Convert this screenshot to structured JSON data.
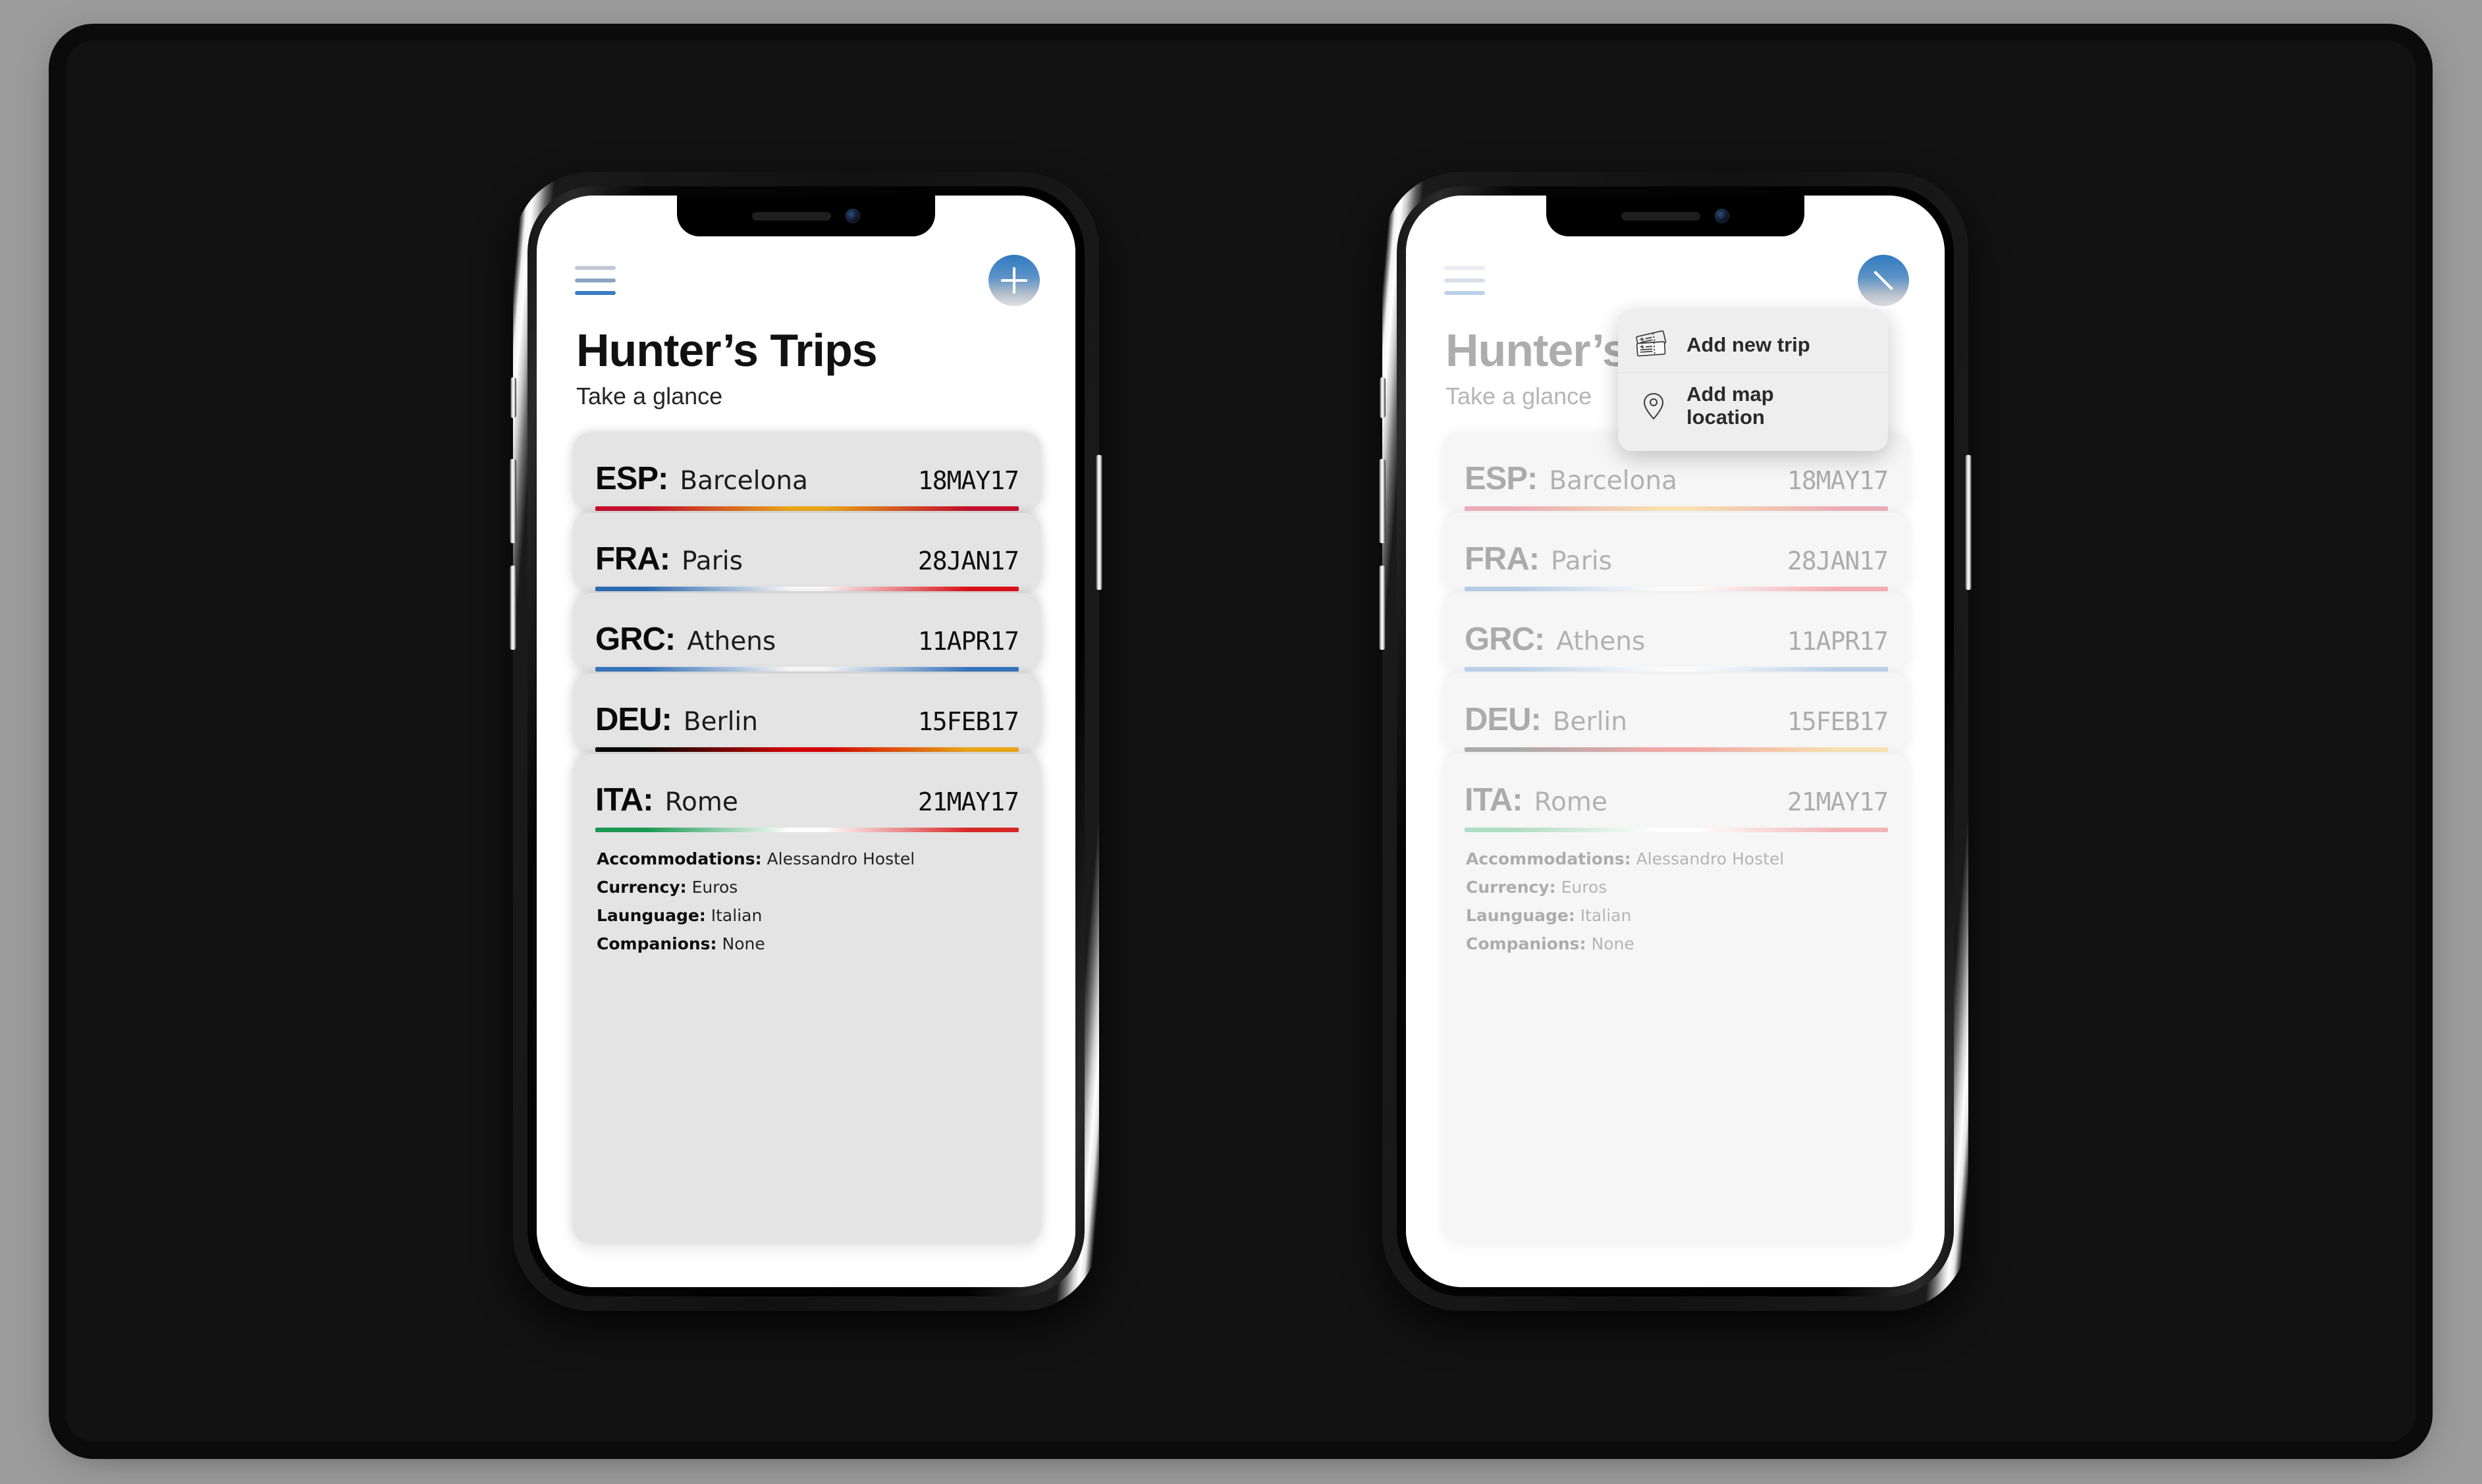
{
  "app": {
    "title": "Hunter’s Trips",
    "subtitle": "Take a glance"
  },
  "colors": {
    "stage_background": "#121212",
    "page_background": "#9b9b9b",
    "card_background": "#e4e4e4",
    "accent_blue": "#3b7cc4",
    "menu_background": "#eeeeee"
  },
  "topbar": {
    "menu_icon": "hamburger-icon",
    "add_icon": "plus-icon",
    "close_icon": "close-icon"
  },
  "trips": [
    {
      "code": "ESP:",
      "city": "Barcelona",
      "date": "18MAY17",
      "flag": "spain",
      "flag_colors": [
        "#c8102e",
        "#f0ad1c",
        "#c8102e"
      ]
    },
    {
      "code": "FRA:",
      "city": "Paris",
      "date": "28JAN17",
      "flag": "france",
      "flag_colors": [
        "#2f6fb5",
        "#ffffff",
        "#e1131d"
      ]
    },
    {
      "code": "GRC:",
      "city": "Athens",
      "date": "11APR17",
      "flag": "greece",
      "flag_colors": [
        "#3a79bf",
        "#ffffff",
        "#3a79bf"
      ]
    },
    {
      "code": "DEU:",
      "city": "Berlin",
      "date": "15FEB17",
      "flag": "germany",
      "flag_colors": [
        "#0a0a0a",
        "#dd0000",
        "#f0ad1c"
      ]
    },
    {
      "code": "ITA:",
      "city": "Rome",
      "date": "21MAY17",
      "flag": "italy",
      "flag_colors": [
        "#1a9850",
        "#ffffff",
        "#d62828"
      ],
      "expanded": true,
      "details": [
        {
          "label": "Accommodations:",
          "value": "Alessandro Hostel"
        },
        {
          "label": "Currency:",
          "value": "Euros"
        },
        {
          "label": "Launguage:",
          "value": "Italian"
        },
        {
          "label": "Companions:",
          "value": "None"
        }
      ]
    }
  ],
  "menu": {
    "items": [
      {
        "label": "Add new trip",
        "icon": "tickets-icon"
      },
      {
        "label": "Add map location",
        "icon": "map-pin-icon"
      }
    ]
  }
}
